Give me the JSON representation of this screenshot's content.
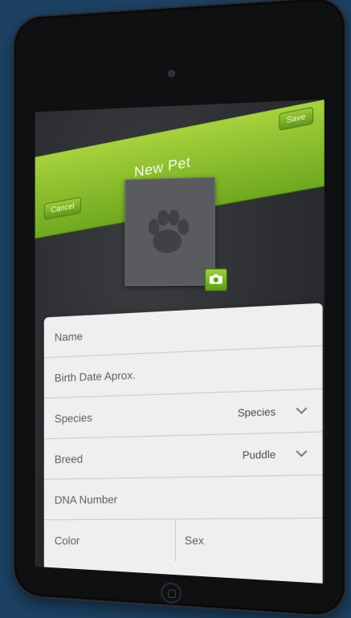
{
  "navbar": {
    "title": "New Pet",
    "cancel_label": "Cancel",
    "save_label": "Save"
  },
  "photo": {
    "placeholder_icon": "paw-icon",
    "camera_icon": "camera-icon"
  },
  "form": {
    "fields": [
      {
        "label": "Name"
      },
      {
        "label": "Birth Date Aprox."
      },
      {
        "label": "Species",
        "value": "Species"
      },
      {
        "label": "Breed",
        "value": "Puddle"
      },
      {
        "label": "DNA Number"
      }
    ],
    "color_label": "Color",
    "sex_label": "Sex"
  },
  "colors": {
    "background": "#1c4163",
    "accent_green": "#8cc63f",
    "device": "#0f1012"
  }
}
